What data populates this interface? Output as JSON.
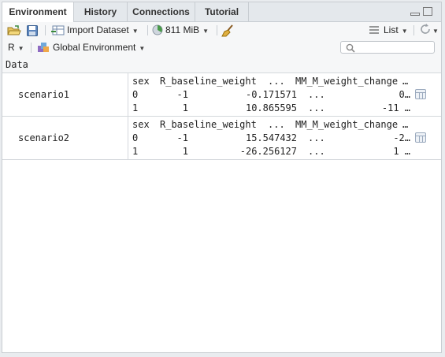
{
  "tabs": [
    {
      "label": "Environment",
      "active": true
    },
    {
      "label": "History",
      "active": false
    },
    {
      "label": "Connections",
      "active": false
    },
    {
      "label": "Tutorial",
      "active": false
    }
  ],
  "toolbar": {
    "import_label": "Import Dataset",
    "memory_label": "811 MiB",
    "view_label": "List"
  },
  "toolbar2": {
    "language": "R",
    "environment": "Global Environment",
    "search_placeholder": ""
  },
  "section_title": "Data",
  "datasets": [
    {
      "name": "scenario1",
      "header": [
        "sex",
        "R_baseline_weight",
        "...",
        "MM_M_weight_change",
        "…"
      ],
      "rows": [
        [
          "0",
          "-1",
          "-0.171571",
          "...",
          "0…"
        ],
        [
          "1",
          "1",
          "10.865595",
          "...",
          "-11 …"
        ]
      ]
    },
    {
      "name": "scenario2",
      "header": [
        "sex",
        "R_baseline_weight",
        "...",
        "MM_M_weight_change",
        "…"
      ],
      "rows": [
        [
          "0",
          "-1",
          "15.547432",
          "...",
          "-2…"
        ],
        [
          "1",
          "1",
          "-26.256127",
          "...",
          "1 …"
        ]
      ]
    }
  ],
  "colors": {
    "tabbar_bg": "#e4e8ec",
    "toolbar_bg": "#f6f7f8",
    "border": "#c8cdd2"
  }
}
